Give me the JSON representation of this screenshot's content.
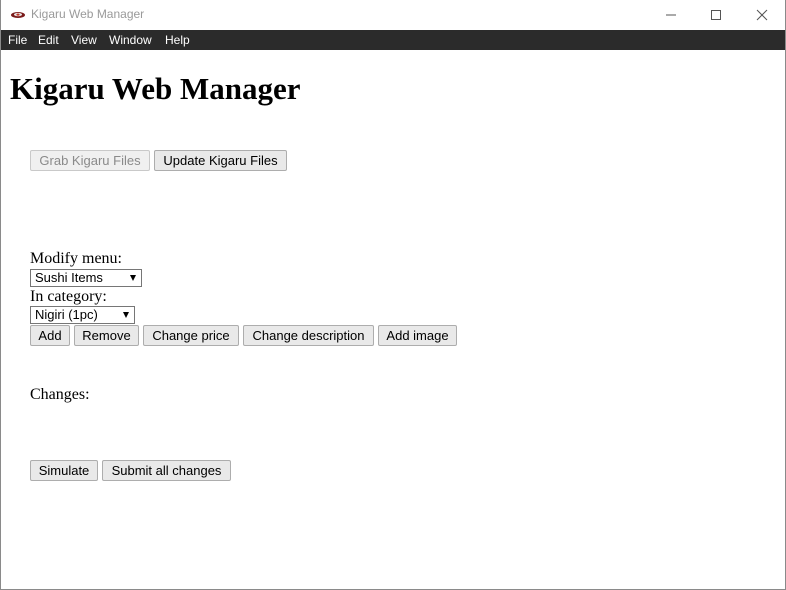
{
  "window": {
    "title": "Kigaru Web Manager",
    "controls": [
      "minimize-icon",
      "maximize-icon",
      "close-icon"
    ]
  },
  "menubar": {
    "items": [
      "File",
      "Edit",
      "View",
      "Window",
      "Help"
    ]
  },
  "main": {
    "heading": "Kigaru Web Manager",
    "grab_button": "Grab Kigaru Files",
    "update_button": "Update Kigaru Files",
    "modify_menu_label": "Modify menu:",
    "menu_select_value": "Sushi Items",
    "category_label": "In category:",
    "category_select_value": "Nigiri (1pc)",
    "actions": {
      "add": "Add",
      "remove": "Remove",
      "change_price": "Change price",
      "change_description": "Change description",
      "add_image": "Add image"
    },
    "changes_label": "Changes:",
    "simulate_button": "Simulate",
    "submit_button": "Submit all changes"
  },
  "colors": {
    "menubar_bg": "#2b2b2b",
    "button_bg": "#e9e9e9",
    "title_text": "#9a9a9a"
  }
}
